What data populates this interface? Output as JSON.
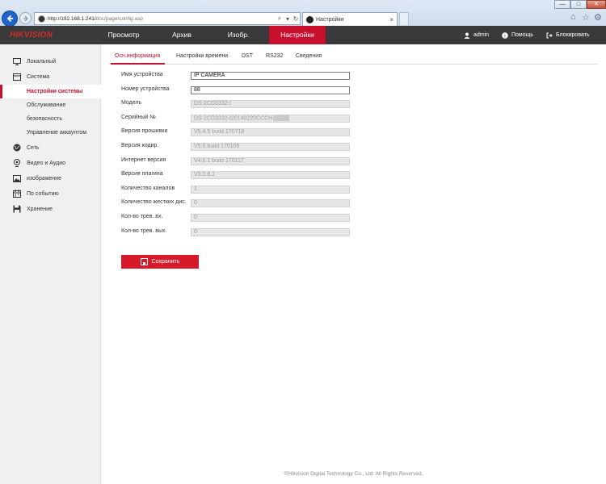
{
  "browser": {
    "url_host": "http://192.168.1.241/",
    "url_path": "doc/page/config.asp",
    "tab_title": "Настройки",
    "tab_close": "×",
    "search_glyph": "⌕",
    "dropdown_glyph": "▾",
    "refresh_glyph": "↻",
    "window_min": "—",
    "window_max": "□",
    "window_close": "✕",
    "icons": [
      "back-arrow-icon",
      "forward-arrow-icon",
      "home-icon",
      "star-icon",
      "gear-icon"
    ]
  },
  "app": {
    "logo": "HIKVISION",
    "nav": {
      "preview": "Просмотр",
      "archive": "Архив",
      "image": "Изобр.",
      "settings": "Настройки"
    },
    "user": "admin",
    "help": "Помощь",
    "logout": "Блокировать",
    "accent_color": "#c8102e",
    "header_color": "#3a3a3a"
  },
  "sidebar": {
    "local": "Локальный",
    "system": "Система",
    "system_sub": {
      "settings": "Настройки системы",
      "maintenance": "Обслуживание",
      "security": "безопасность",
      "accounts": "Управление аккаунтом"
    },
    "network": "Сеть",
    "video_audio": "Видео и Аудио",
    "image": "изображение",
    "event": "По событию",
    "storage": "Хранение"
  },
  "tabs": {
    "basic": "Осн.информация",
    "time": "Настройки времени",
    "dst": "DST",
    "rs232": "RS232",
    "about": "Сведения"
  },
  "fields": {
    "device_name": {
      "label": "Имя устройства",
      "value": "IP CAMERA"
    },
    "device_no": {
      "label": "Номер устройства",
      "value": "88"
    },
    "model": {
      "label": "Модель",
      "value": "DS-2CD3332-I"
    },
    "serial": {
      "label": "Серийный №",
      "value": "DS-2CD3332-I20140220CCCH"
    },
    "firmware": {
      "label": "Версия прошивки",
      "value": "V5.4.5 build 170718"
    },
    "encoder": {
      "label": "Версия кодир.",
      "value": "V5.0 build 170105"
    },
    "web": {
      "label": "Интернет версия",
      "value": "V4.0.1 build 170117"
    },
    "plugin": {
      "label": "Версия плагина",
      "value": "V3.0.6.1"
    },
    "channels": {
      "label": "Количество каналов",
      "value": "1"
    },
    "hdd": {
      "label": "Количество жестких дис.",
      "value": "0"
    },
    "alarm_in": {
      "label": "Кол-во трев. вх.",
      "value": "0"
    },
    "alarm_out": {
      "label": "Кол-во трев. вых.",
      "value": "0"
    }
  },
  "save_label": "Сохранить",
  "footer": "©Hikvision Digital Technology Co., Ltd. All Rights Reserved."
}
